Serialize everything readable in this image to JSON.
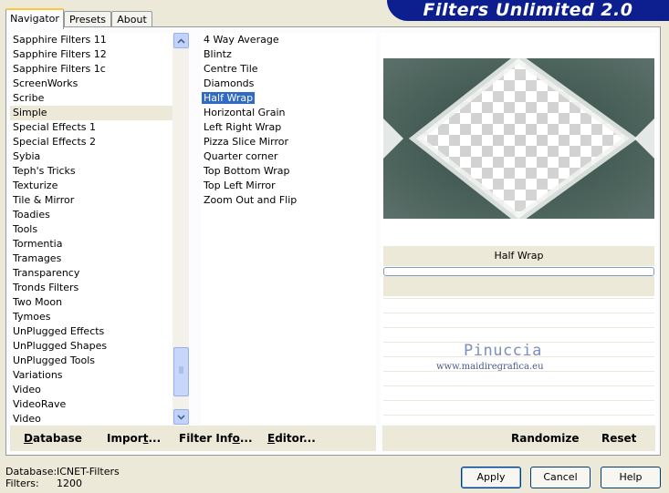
{
  "window": {
    "banner_title": "Filters Unlimited 2.0",
    "tabs": [
      {
        "label": "Navigator"
      },
      {
        "label": "Presets"
      },
      {
        "label": "About"
      }
    ]
  },
  "categories": {
    "items": [
      "Sapphire Filters 11",
      "Sapphire Filters 12",
      "Sapphire Filters 1c",
      "ScreenWorks",
      "Scribe",
      "Simple",
      "Special Effects 1",
      "Special Effects 2",
      "Sybia",
      "Teph's Tricks",
      "Texturize",
      "Tile & Mirror",
      "Toadies",
      "Tools",
      "Tormentia",
      "Tramages",
      "Transparency",
      "Tronds Filters",
      "Two Moon",
      "Tymoes",
      "UnPlugged Effects",
      "UnPlugged Shapes",
      "UnPlugged Tools",
      "Variations",
      "Video",
      "VideoRave",
      "Video"
    ],
    "selected_index": 5
  },
  "filters": {
    "items": [
      "4 Way Average",
      "Blintz",
      "Centre Tile",
      "Diamonds",
      "Half Wrap",
      "Horizontal Grain",
      "Left Right Wrap",
      "Pizza Slice Mirror",
      "Quarter corner",
      "Top Bottom Wrap",
      "Top Left Mirror",
      "Zoom Out and Flip"
    ],
    "selected_index": 4
  },
  "scroll_icons": {
    "up": "chevron-up-icon",
    "down": "chevron-down-icon",
    "grip": "grip-icon"
  },
  "preview": {
    "filter_name": "Half Wrap",
    "watermark_name": "Pinuccia",
    "watermark_url": "www.maidiregrafica.eu"
  },
  "toolbar": {
    "database": "Database",
    "import": "Import...",
    "filter_info": "Filter Info...",
    "editor": "Editor...",
    "randomize": "Randomize",
    "reset": "Reset"
  },
  "status": {
    "database_label": "Database:",
    "database_value": "ICNET-Filters",
    "filters_label": "Filters:",
    "filters_value": "1200"
  },
  "buttons": {
    "apply": "Apply",
    "cancel": "Cancel",
    "help": "Help"
  },
  "colors": {
    "banner": "#0d1f8e",
    "selection": "#316ac5",
    "preview_dark": "#2f4a42"
  }
}
